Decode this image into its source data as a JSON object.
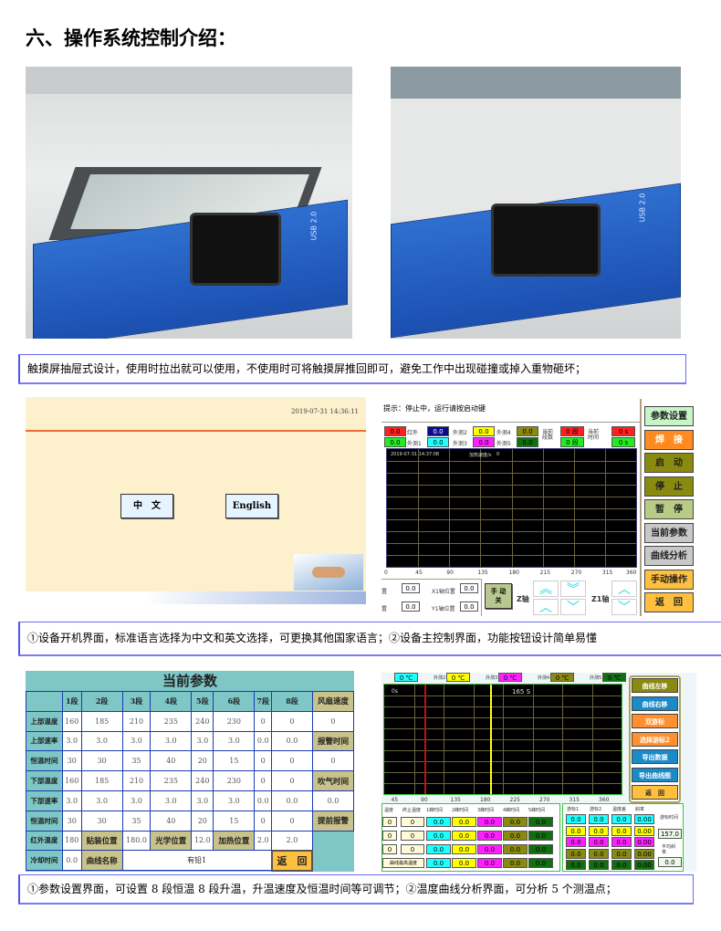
{
  "page_title": "六、操作系统控制介绍：",
  "photos": {
    "usb_label": "USB 2.0"
  },
  "caption1": "触摸屏抽屉式设计，使用时拉出就可以使用，不使用时可将触摸屏推回即可，避免工作中出现碰撞或掉入重物砸坏；",
  "screen_language": {
    "datetime": "2019-07-31 14:36:11",
    "chinese_button": "中　文",
    "english_button": "English"
  },
  "screen_main": {
    "prompt": "提示：停止中，运行请按启动键",
    "indicators": [
      {
        "value": "0.0",
        "color": "#ff2020"
      },
      {
        "label": "红外",
        "value": "0.0",
        "color": "#0a0a90",
        "text": "#fff"
      },
      {
        "label": "外测2",
        "value": "0.0",
        "color": "#ffff00"
      },
      {
        "label": "外测4",
        "value": "0.0",
        "color": "#8a8a10"
      },
      {
        "value": "0.0",
        "color": "#20ee20"
      },
      {
        "label": "外测1",
        "value": "0.0",
        "color": "#20ffff"
      },
      {
        "label": "外测3",
        "value": "0.0",
        "color": "#ff20ff"
      },
      {
        "label": "外测5",
        "value": "0.0",
        "color": "#107010"
      }
    ],
    "segment_label": "当前段数",
    "segment_values": [
      "0 段",
      "0 段"
    ],
    "time_label": "当前时间",
    "time_values": [
      "0 s",
      "0 s"
    ],
    "chart_datetime": "2019-07-31 14:37:08",
    "heating_rate_label": "加热速度/s",
    "heating_rate_value": "0",
    "x_ticks": [
      "0",
      "45",
      "90",
      "135",
      "180",
      "215",
      "270",
      "315",
      "360"
    ],
    "x_axis_label": "置",
    "x_axis_value": "0.0",
    "x1_axis_label": "X1轴位置",
    "x1_axis_value": "0.0",
    "y_axis_label": "置",
    "y_axis_value": "0.0",
    "y1_axis_label": "Y1轴位置",
    "y1_axis_value": "0.0",
    "manual_button": "手 动\n关",
    "z_axis_label": "Z轴",
    "z1_axis_label": "Z1轴",
    "side_buttons": [
      {
        "label": "参数设置",
        "bg": "#c8f5c8"
      },
      {
        "label": "焊　接",
        "bg": "#ff8a20",
        "color": "#fff"
      },
      {
        "label": "启　动",
        "bg": "#8a8a10"
      },
      {
        "label": "停　止",
        "bg": "#8a8a10"
      },
      {
        "label": "暂　停",
        "bg": "#b8cc88"
      },
      {
        "label": "当前参数",
        "bg": "#c8c8c8"
      },
      {
        "label": "曲线分析",
        "bg": "#c8c8c8"
      },
      {
        "label": "手动操作",
        "bg": "#ffc040"
      },
      {
        "label": "返　回",
        "bg": "#ffc040"
      }
    ]
  },
  "caption2": "①设备开机界面，标准语言选择为中文和英文选择，可更换其他国家语言；②设备主控制界面，功能按钮设计简单易懂",
  "screen_params": {
    "title": "当前参数",
    "columns": [
      "",
      "1段",
      "2段",
      "3段",
      "4段",
      "5段",
      "6段",
      "7段",
      "8段"
    ],
    "rows": [
      {
        "label": "上部温度",
        "values": [
          "160",
          "185",
          "210",
          "235",
          "240",
          "230",
          "0",
          "0"
        ]
      },
      {
        "label": "上部速率",
        "values": [
          "3.0",
          "3.0",
          "3.0",
          "3.0",
          "3.0",
          "3.0",
          "0.0",
          "0.0"
        ]
      },
      {
        "label": "恒温时间",
        "values": [
          "30",
          "30",
          "35",
          "40",
          "20",
          "15",
          "0",
          "0"
        ]
      },
      {
        "label": "下部温度",
        "values": [
          "160",
          "185",
          "210",
          "235",
          "240",
          "230",
          "0",
          "0"
        ]
      },
      {
        "label": "下部速率",
        "values": [
          "3.0",
          "3.0",
          "3.0",
          "3.0",
          "3.0",
          "3.0",
          "0.0",
          "0.0"
        ]
      },
      {
        "label": "恒温时间",
        "values": [
          "30",
          "30",
          "35",
          "40",
          "20",
          "15",
          "0",
          "0"
        ]
      }
    ],
    "side": [
      {
        "label": "风扇速度",
        "value": "0"
      },
      {
        "label": "报警时间",
        "value": "0"
      },
      {
        "label": "吹气时间",
        "value": "0.0"
      },
      {
        "label": "提前报警",
        "value": "2.0"
      }
    ],
    "ir_temp_label": "红外温度",
    "ir_temp_value": "180",
    "mount_pos_label": "贴装位置",
    "mount_pos_value": "180.0",
    "optical_pos_label": "光学位置",
    "optical_pos_value": "12.0",
    "heat_pos_label": "加热位置",
    "heat_pos_value": "2.0",
    "cool_time_label": "冷却时间",
    "cool_time_value": "0.0",
    "curve_name_label": "曲线名称",
    "curve_name_value": "有铅1",
    "back_button": "返　回"
  },
  "screen_curve": {
    "probes": [
      {
        "label": "",
        "value": "0 ℃",
        "color": "#20ffff"
      },
      {
        "label": "外测2",
        "value": "0 ℃",
        "color": "#ffff00"
      },
      {
        "label": "外测3",
        "value": "0 ℃",
        "color": "#ff20ff"
      },
      {
        "label": "外测4",
        "value": "0 ℃",
        "color": "#8a8a10"
      },
      {
        "label": "外测5",
        "value": "0 ℃",
        "color": "#107010"
      }
    ],
    "cursor1_label": "0s",
    "cursor2_label": "165 S",
    "x_ticks": [
      "45",
      "90",
      "135",
      "180",
      "225",
      "270",
      "315",
      "360"
    ],
    "side_buttons": [
      {
        "label": "曲线左移",
        "bg": "#8a8a10"
      },
      {
        "label": "曲线右移",
        "bg": "#1a8ac8"
      },
      {
        "label": "双游标",
        "bg": "#ff9030"
      },
      {
        "label": "选择游标2",
        "bg": "#ff9030"
      },
      {
        "label": "导出数据",
        "bg": "#1a8ac8"
      },
      {
        "label": "导出曲线图",
        "bg": "#1a8ac8"
      },
      {
        "label": "返　回",
        "bg": "#ffc040"
      }
    ],
    "table_headers": [
      "温度",
      "终止温度",
      "1峰时间",
      "2峰时间",
      "3峰时间",
      "4峰时间",
      "5峰时间"
    ],
    "row_values": [
      "0",
      "0",
      "0.0",
      "0.0",
      "0.0",
      "0.0",
      "0.0"
    ],
    "last_row_label": "曲线最高温度",
    "colors": [
      "#20ffff",
      "#ffff00",
      "#ff20ff",
      "#8a8a10",
      "#107010"
    ],
    "cursor_headers": [
      "游标1",
      "游标2",
      "温度差",
      "斜率"
    ],
    "cursor_values": [
      "0.0",
      "0.0",
      "0.0",
      "0.00"
    ],
    "cursor_time_label": "游标时间",
    "cursor_time_value": "157.0",
    "avg_slope_label": "平均斜率",
    "avg_slope_value": "0.0"
  },
  "caption3": "①参数设置界面，可设置 8 段恒温 8 段升温，升温速度及恒温时间等可调节；②温度曲线分析界面，可分析 5 个测温点；"
}
